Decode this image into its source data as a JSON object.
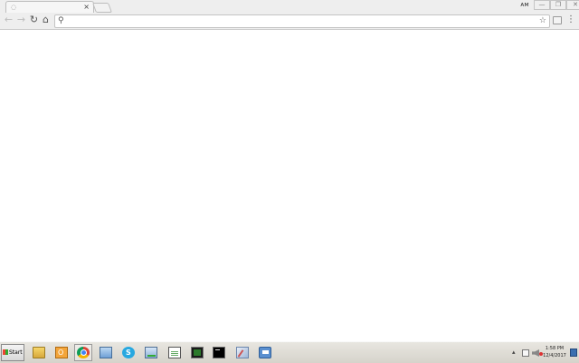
{
  "browser": {
    "tab": {
      "favicon": "loading-icon",
      "close_label": "×"
    },
    "new_tab": {
      "icon": "new-tab-icon"
    },
    "window": {
      "user_badge": "ᴀᴍ",
      "minimize_label": "—",
      "maximize_label": "❐",
      "close_label": "✕"
    },
    "toolbar": {
      "back_label": "←",
      "forward_label": "→",
      "reload_label": "↻",
      "home_label": "⌂",
      "search_icon_label": "⚲",
      "address_value": "",
      "address_placeholder": "",
      "bookmark_label": "☆",
      "menu_label": "⋮"
    }
  },
  "taskbar": {
    "start_label": "Start",
    "pinned": [
      {
        "name": "file-explorer-icon"
      },
      {
        "name": "outlook-icon"
      },
      {
        "name": "chrome-icon"
      },
      {
        "name": "remote-desktop-icon"
      },
      {
        "name": "skype-icon"
      },
      {
        "name": "network-icon"
      },
      {
        "name": "notepad-icon"
      },
      {
        "name": "monitor-icon"
      },
      {
        "name": "terminal-icon"
      },
      {
        "name": "paint-icon"
      },
      {
        "name": "chat-icon"
      }
    ],
    "tray": {
      "expand_label": "▴",
      "time": "1:58 PM",
      "date": "12/4/2017"
    }
  },
  "colors": {
    "chrome_bg": "#eeeeee",
    "taskbar_bg": "#d6d3cb",
    "content_bg": "#ffffff"
  }
}
